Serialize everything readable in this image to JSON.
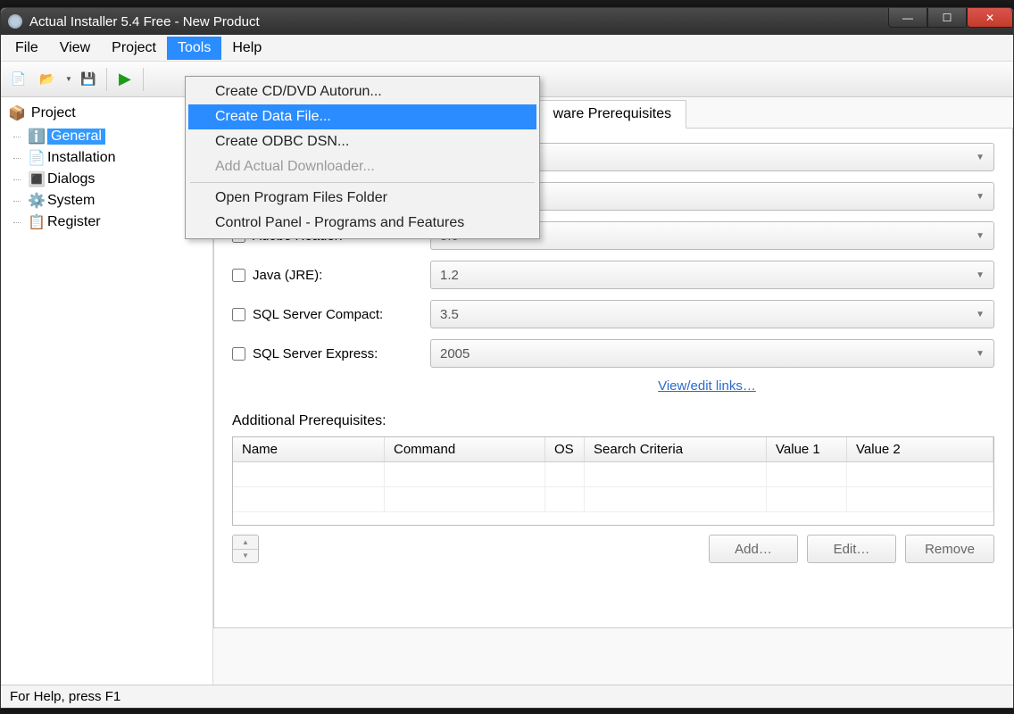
{
  "window": {
    "title": "Actual Installer 5.4 Free - New Product"
  },
  "menubar": {
    "file": "File",
    "view": "View",
    "project": "Project",
    "tools": "Tools",
    "help": "Help"
  },
  "tools_menu": {
    "create_cd": "Create CD/DVD Autorun...",
    "create_data": "Create Data File...",
    "create_odbc": "Create ODBC DSN...",
    "add_downloader": "Add Actual Downloader...",
    "open_program_files": "Open Program Files Folder",
    "control_panel": "Control Panel - Programs and Features"
  },
  "sidebar": {
    "root": "Project",
    "items": [
      {
        "icon": "ℹ️",
        "label": "General"
      },
      {
        "icon": "📄",
        "label": "Installation"
      },
      {
        "icon": "🔳",
        "label": "Dialogs"
      },
      {
        "icon": "⚙️",
        "label": "System"
      },
      {
        "icon": "📋",
        "label": "Register"
      }
    ]
  },
  "tabs": {
    "right_partial": "ware Prerequisites"
  },
  "prereqs": [
    {
      "label": "Adobe Reader:",
      "value": "5.0"
    },
    {
      "label": "Java (JRE):",
      "value": "1.2"
    },
    {
      "label": "SQL Server Compact:",
      "value": "3.5"
    },
    {
      "label": "SQL Server Express:",
      "value": "2005"
    }
  ],
  "hidden_combos": {
    "a": "",
    "b": ""
  },
  "link": "View/edit links…",
  "additional_label": "Additional Prerequisites:",
  "grid_headers": {
    "name": "Name",
    "command": "Command",
    "os": "OS",
    "search": "Search Criteria",
    "v1": "Value 1",
    "v2": "Value 2"
  },
  "buttons": {
    "add": "Add…",
    "edit": "Edit…",
    "remove": "Remove"
  },
  "statusbar": "For Help, press F1"
}
